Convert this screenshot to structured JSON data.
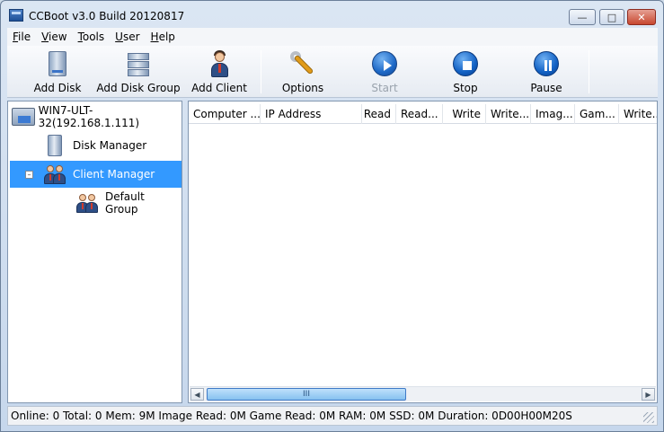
{
  "window": {
    "title": "CCBoot v3.0 Build 20120817"
  },
  "menu": [
    {
      "label": "File",
      "accel": "F",
      "rest": "ile"
    },
    {
      "label": "View",
      "accel": "V",
      "rest": "iew"
    },
    {
      "label": "Tools",
      "accel": "T",
      "rest": "ools"
    },
    {
      "label": "User",
      "accel": "U",
      "rest": "ser"
    },
    {
      "label": "Help",
      "accel": "H",
      "rest": "elp"
    }
  ],
  "toolbar": {
    "add_disk": "Add Disk",
    "add_disk_group": "Add Disk Group",
    "add_client": "Add Client",
    "options": "Options",
    "start": "Start",
    "stop": "Stop",
    "pause": "Pause"
  },
  "tree": {
    "server": "WIN7-ULT-32(192.168.1.111)",
    "disk_manager": "Disk Manager",
    "client_manager": "Client Manager",
    "default_group": "Default Group"
  },
  "grid": {
    "columns": [
      "Computer ...",
      "IP Address",
      "Read",
      "Read...",
      "Write",
      "Write...",
      "Imag...",
      "Gam...",
      "Write..."
    ]
  },
  "scroll": {
    "thumb_glyph": "III"
  },
  "status": {
    "text": "Online: 0 Total: 0 Mem: 9M Image Read: 0M Game Read: 0M RAM: 0M SSD: 0M Duration: 0D00H00M20S"
  }
}
